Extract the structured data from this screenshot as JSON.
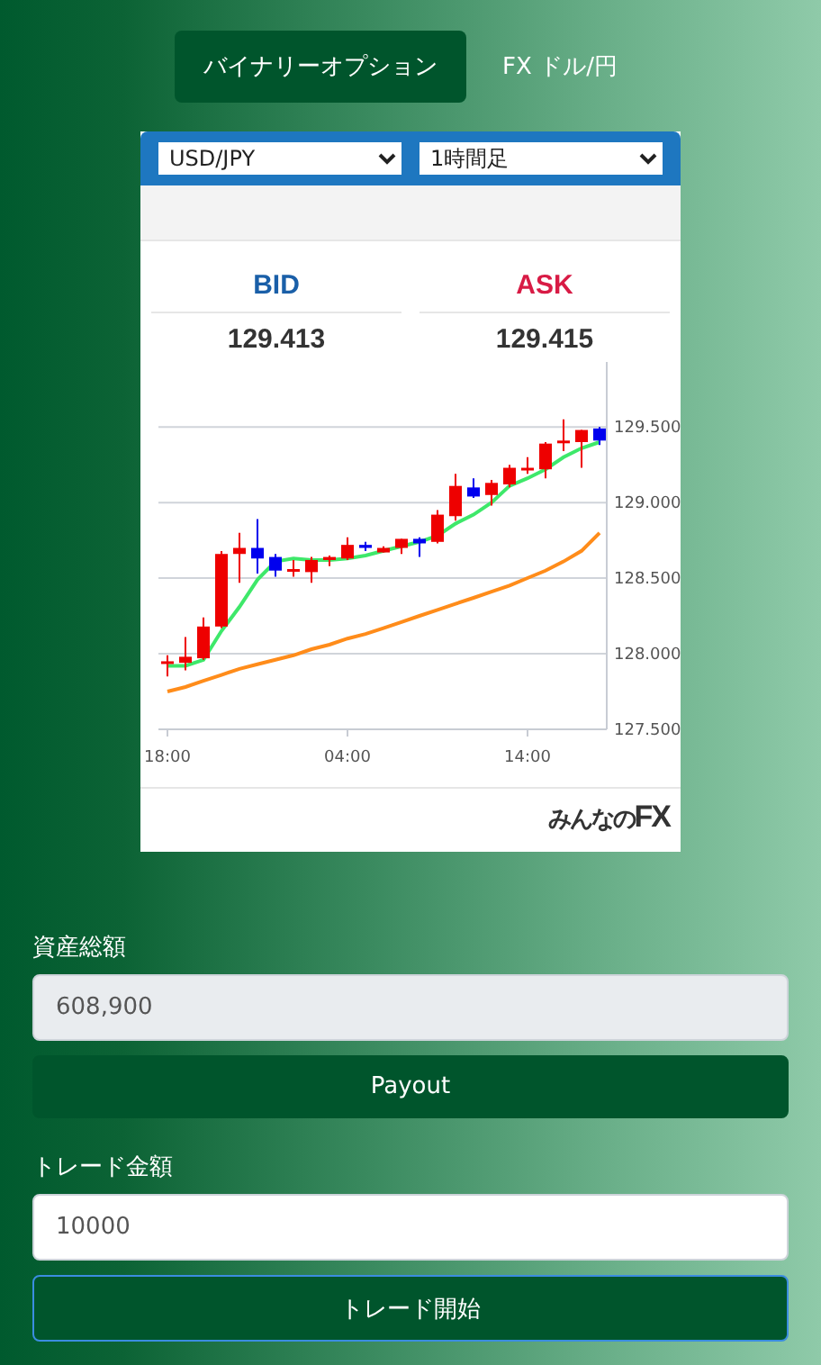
{
  "tabs": [
    {
      "label": "バイナリーオプション",
      "selected": true
    },
    {
      "label": "FX ドル/円",
      "selected": false
    }
  ],
  "widget": {
    "pair_select": "USD/JPY",
    "timeframe_select": "1時間足",
    "quotes": [
      {
        "kind": "bid",
        "label": "BID",
        "value": "129.413"
      },
      {
        "kind": "ask",
        "label": "ASK",
        "value": "129.415"
      }
    ],
    "chart_data": {
      "type": "candlestick",
      "categories": [
        "18:00",
        null,
        null,
        null,
        null,
        null,
        null,
        null,
        null,
        null,
        "04:00",
        null,
        null,
        null,
        null,
        null,
        null,
        null,
        null,
        null,
        "14:00",
        null,
        null,
        null,
        null
      ],
      "ylim": [
        127.5,
        129.93
      ],
      "yticks": [
        {
          "value": 127.5,
          "label": "127.500"
        },
        {
          "value": 128,
          "label": "128.000"
        },
        {
          "value": 128.5,
          "label": "128.500"
        },
        {
          "value": 129,
          "label": "129.000"
        },
        {
          "value": 129.5,
          "label": "129.500"
        }
      ],
      "grid": true,
      "series": [
        {
          "type": "line",
          "color": "#3ee86a",
          "values": [
            127.92,
            127.92,
            127.96,
            128.15,
            128.31,
            128.49,
            128.61,
            128.63,
            128.62,
            128.62,
            128.63,
            128.65,
            128.68,
            128.71,
            128.74,
            128.78,
            128.86,
            128.92,
            129.0,
            129.11,
            129.16,
            129.22,
            129.3,
            129.36,
            129.4
          ]
        },
        {
          "type": "line",
          "color": "#ff8c1a",
          "values": [
            127.75,
            127.78,
            127.82,
            127.86,
            127.9,
            127.93,
            127.96,
            127.99,
            128.03,
            128.06,
            128.1,
            128.13,
            128.17,
            128.21,
            128.25,
            128.29,
            128.33,
            128.37,
            128.41,
            128.45,
            128.5,
            128.55,
            128.61,
            128.68,
            128.8
          ]
        }
      ],
      "ohlc": [
        [
          127.94,
          127.99,
          127.85,
          127.95
        ],
        [
          127.94,
          128.11,
          127.89,
          127.98
        ],
        [
          127.97,
          128.24,
          127.96,
          128.18
        ],
        [
          128.18,
          128.68,
          128.17,
          128.66
        ],
        [
          128.66,
          128.8,
          128.47,
          128.7
        ],
        [
          128.7,
          128.89,
          128.53,
          128.63
        ],
        [
          128.64,
          128.66,
          128.51,
          128.55
        ],
        [
          128.55,
          128.62,
          128.51,
          128.56
        ],
        [
          128.54,
          128.64,
          128.47,
          128.62
        ],
        [
          128.62,
          128.65,
          128.58,
          128.64
        ],
        [
          128.63,
          128.77,
          128.62,
          128.72
        ],
        [
          128.72,
          128.74,
          128.68,
          128.7
        ],
        [
          128.67,
          128.71,
          128.67,
          128.7
        ],
        [
          128.7,
          128.76,
          128.66,
          128.76
        ],
        [
          128.76,
          128.77,
          128.64,
          128.73
        ],
        [
          128.74,
          128.95,
          128.73,
          128.92
        ],
        [
          128.91,
          129.19,
          128.88,
          129.11
        ],
        [
          129.1,
          129.16,
          129.03,
          129.04
        ],
        [
          129.05,
          129.15,
          128.98,
          129.13
        ],
        [
          129.12,
          129.25,
          129.1,
          129.23
        ],
        [
          129.22,
          129.3,
          129.19,
          129.23
        ],
        [
          129.22,
          129.4,
          129.16,
          129.39
        ],
        [
          129.4,
          129.55,
          129.34,
          129.41
        ],
        [
          129.4,
          129.48,
          129.23,
          129.48
        ],
        [
          129.49,
          129.5,
          129.38,
          129.41
        ]
      ]
    },
    "logo": {
      "text": "みんなの",
      "accent": "FX"
    }
  },
  "form": {
    "asset_label": "資産総額",
    "asset_value": "608,900",
    "payout_button": "Payout",
    "amount_label": "トレード金額",
    "amount_value": "10000",
    "start_button": "トレード開始"
  }
}
